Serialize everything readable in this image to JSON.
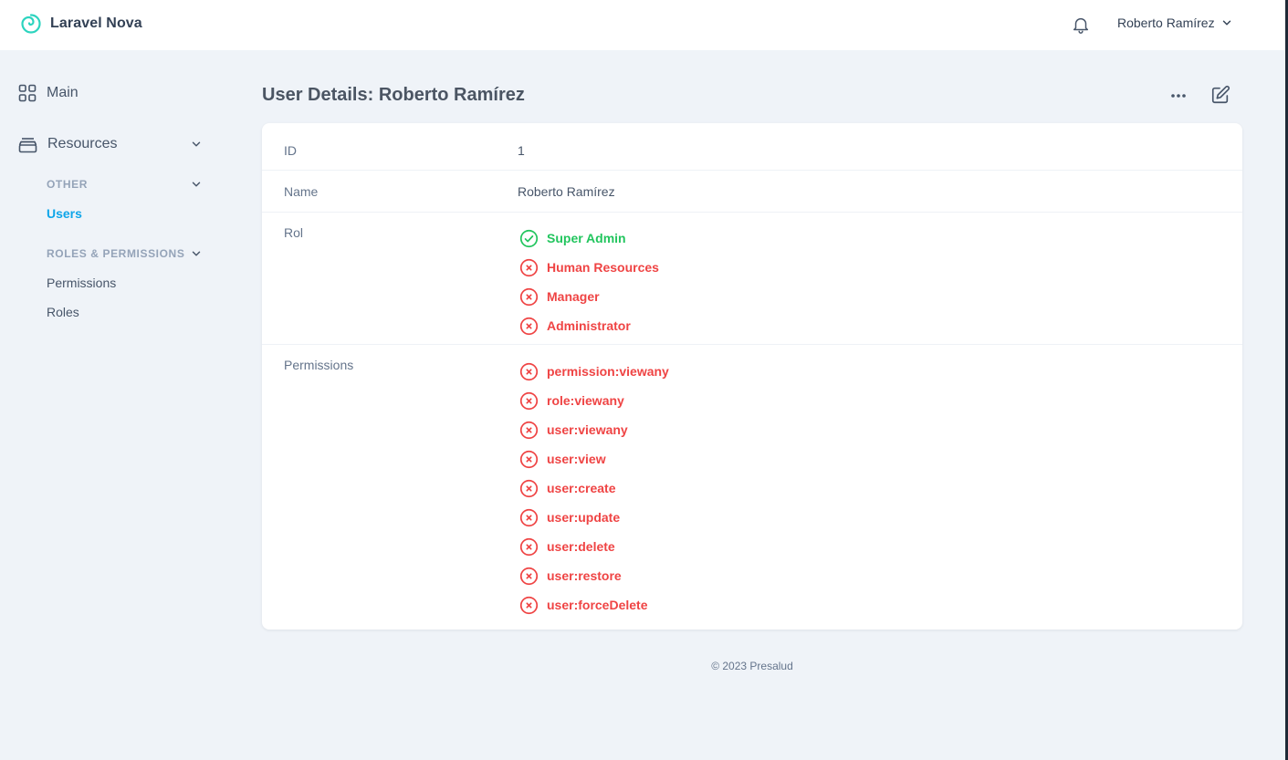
{
  "app": {
    "name": "Laravel Nova",
    "user_name": "Roberto Ramírez"
  },
  "sidebar": {
    "main_label": "Main",
    "resources_label": "Resources",
    "groups": [
      {
        "label": "OTHER",
        "links": [
          "Users"
        ]
      },
      {
        "label": "ROLES & PERMISSIONS",
        "links": [
          "Permissions",
          "Roles"
        ]
      }
    ],
    "active_link": "Users"
  },
  "page": {
    "title": "User Details: Roberto Ramírez"
  },
  "details": {
    "id_label": "ID",
    "id_value": "1",
    "name_label": "Name",
    "name_value": "Roberto Ramírez",
    "rol_label": "Rol",
    "roles": [
      {
        "label": "Super Admin",
        "enabled": true
      },
      {
        "label": "Human Resources",
        "enabled": false
      },
      {
        "label": "Manager",
        "enabled": false
      },
      {
        "label": "Administrator",
        "enabled": false
      }
    ],
    "permissions_label": "Permissions",
    "permissions": [
      {
        "label": "permission:viewany",
        "enabled": false
      },
      {
        "label": "role:viewany",
        "enabled": false
      },
      {
        "label": "user:viewany",
        "enabled": false
      },
      {
        "label": "user:view",
        "enabled": false
      },
      {
        "label": "user:create",
        "enabled": false
      },
      {
        "label": "user:update",
        "enabled": false
      },
      {
        "label": "user:delete",
        "enabled": false
      },
      {
        "label": "user:restore",
        "enabled": false
      },
      {
        "label": "user:forceDelete",
        "enabled": false
      }
    ]
  },
  "footer": {
    "text": "© 2023 Presalud"
  },
  "colors": {
    "brand_teal": "#2dd4bf",
    "active_link": "#0ea5e9",
    "enabled": "#22c55e",
    "disabled": "#ef4444",
    "background": "#eff3f8"
  },
  "icons": {
    "logo": "nova-spiral-logo",
    "bell": "bell-icon",
    "main": "grid-icon",
    "resources": "archive-icon",
    "more": "ellipsis-icon",
    "edit": "pencil-square-icon",
    "enabled": "check-circle-icon",
    "disabled": "x-circle-icon"
  }
}
